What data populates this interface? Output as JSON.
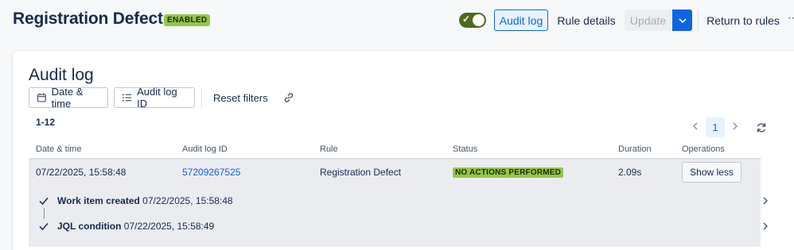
{
  "header": {
    "title": "Registration Defect",
    "state_badge": "ENABLED",
    "toggle_enabled": true,
    "audit_log_button": "Audit log",
    "rule_details_button": "Rule details",
    "update_button": "Update",
    "return_button": "Return to rules"
  },
  "audit": {
    "title": "Audit log",
    "filters": {
      "date_time": "Date & time",
      "audit_log_id": "Audit log ID",
      "reset": "Reset filters"
    },
    "count": "1-12",
    "pagination": {
      "current_page": "1"
    },
    "columns": [
      "Date & time",
      "Audit log ID",
      "Rule",
      "Status",
      "Duration",
      "Operations"
    ],
    "rows": [
      {
        "date_time": "07/22/2025, 15:58:48",
        "audit_log_id": "57209267525",
        "rule": "Registration Defect",
        "status": "NO ACTIONS PERFORMED",
        "duration": "2.09s",
        "operation": "Show less",
        "details": [
          {
            "label": "Work item created",
            "time": "07/22/2025, 15:58:48"
          },
          {
            "label": "JQL condition",
            "time": "07/22/2025, 15:58:49"
          }
        ]
      }
    ]
  },
  "colors": {
    "accent": "#0c66e4",
    "success_lozenge": "#94c748",
    "toggle_on": "#4c6b1f",
    "row_expanded_bg": "#ebecf0"
  },
  "icons": [
    "check-icon",
    "chevron-down-icon",
    "more-icon",
    "calendar-icon",
    "list-icon",
    "link-icon",
    "chevron-left-icon",
    "chevron-right-icon",
    "refresh-icon"
  ]
}
